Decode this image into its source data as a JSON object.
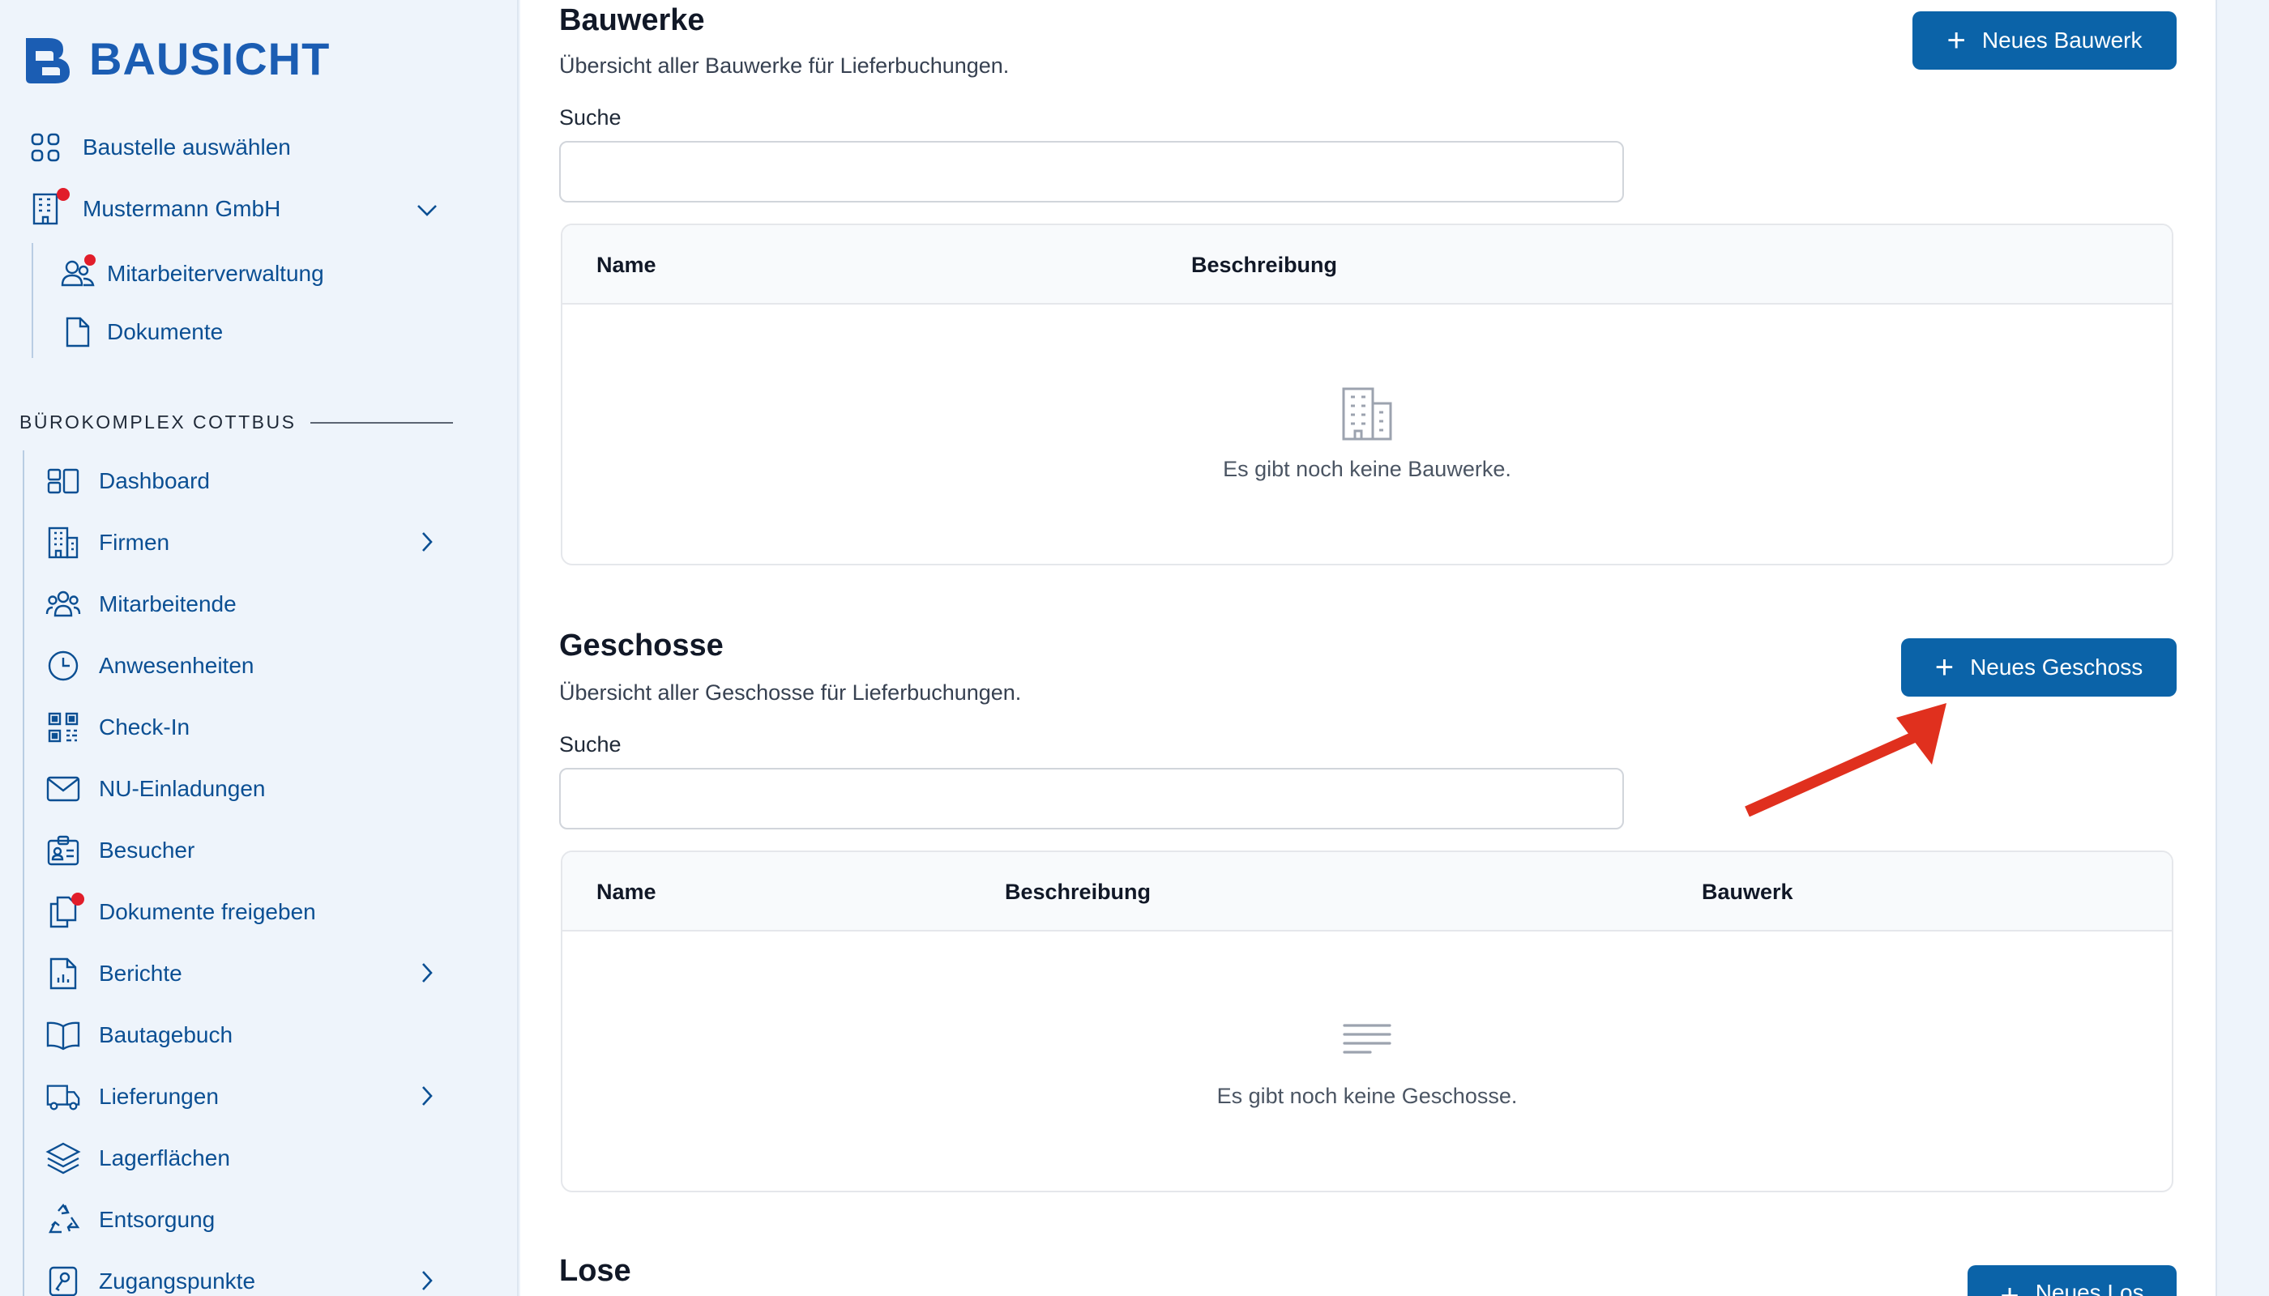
{
  "app": {
    "brand": "BAUSICHT"
  },
  "sidebar": {
    "top_items": [
      {
        "label": "Baustelle auswählen",
        "icon": "grid-icon"
      },
      {
        "label": "Mustermann GmbH",
        "icon": "building-icon"
      },
      {
        "label": "Mitarbeiterverwaltung",
        "icon": "users-icon"
      },
      {
        "label": "Dokumente",
        "icon": "document-icon"
      }
    ],
    "section_title": "BÜROKOMPLEX COTTBUS",
    "items": [
      {
        "label": "Dashboard",
        "icon": "dashboard-icon"
      },
      {
        "label": "Firmen",
        "icon": "building-icon"
      },
      {
        "label": "Mitarbeitende",
        "icon": "team-icon"
      },
      {
        "label": "Anwesenheiten",
        "icon": "clock-icon"
      },
      {
        "label": "Check-In",
        "icon": "qr-code-icon"
      },
      {
        "label": "NU-Einladungen",
        "icon": "mail-icon"
      },
      {
        "label": "Besucher",
        "icon": "id-badge-icon"
      },
      {
        "label": "Dokumente freigeben",
        "icon": "documents-icon"
      },
      {
        "label": "Berichte",
        "icon": "report-icon"
      },
      {
        "label": "Bautagebuch",
        "icon": "book-icon"
      },
      {
        "label": "Lieferungen",
        "icon": "truck-icon"
      },
      {
        "label": "Lagerflächen",
        "icon": "layers-icon"
      },
      {
        "label": "Entsorgung",
        "icon": "recycle-icon"
      },
      {
        "label": "Zugangspunkte",
        "icon": "access-icon"
      }
    ]
  },
  "colors": {
    "accent": "#0b63a8",
    "nav_text": "#0b4f93",
    "notification": "#e11d2a",
    "sidebar_bg": "#eef4fb",
    "annotation_arrow": "#e0301e"
  },
  "bauwerke": {
    "title": "Bauwerke",
    "subtitle": "Übersicht aller Bauwerke für Lieferbuchungen.",
    "search_label": "Suche",
    "search_value": "",
    "button": "Neues Bauwerk",
    "columns": [
      "Name",
      "Beschreibung"
    ],
    "empty": "Es gibt noch keine Bauwerke."
  },
  "geschosse": {
    "title": "Geschosse",
    "subtitle": "Übersicht aller Geschosse für Lieferbuchungen.",
    "search_label": "Suche",
    "search_value": "",
    "button": "Neues Geschoss",
    "columns": [
      "Name",
      "Beschreibung",
      "Bauwerk"
    ],
    "empty": "Es gibt noch keine Geschosse."
  },
  "lose": {
    "title": "Lose",
    "button": "Neues Los"
  }
}
